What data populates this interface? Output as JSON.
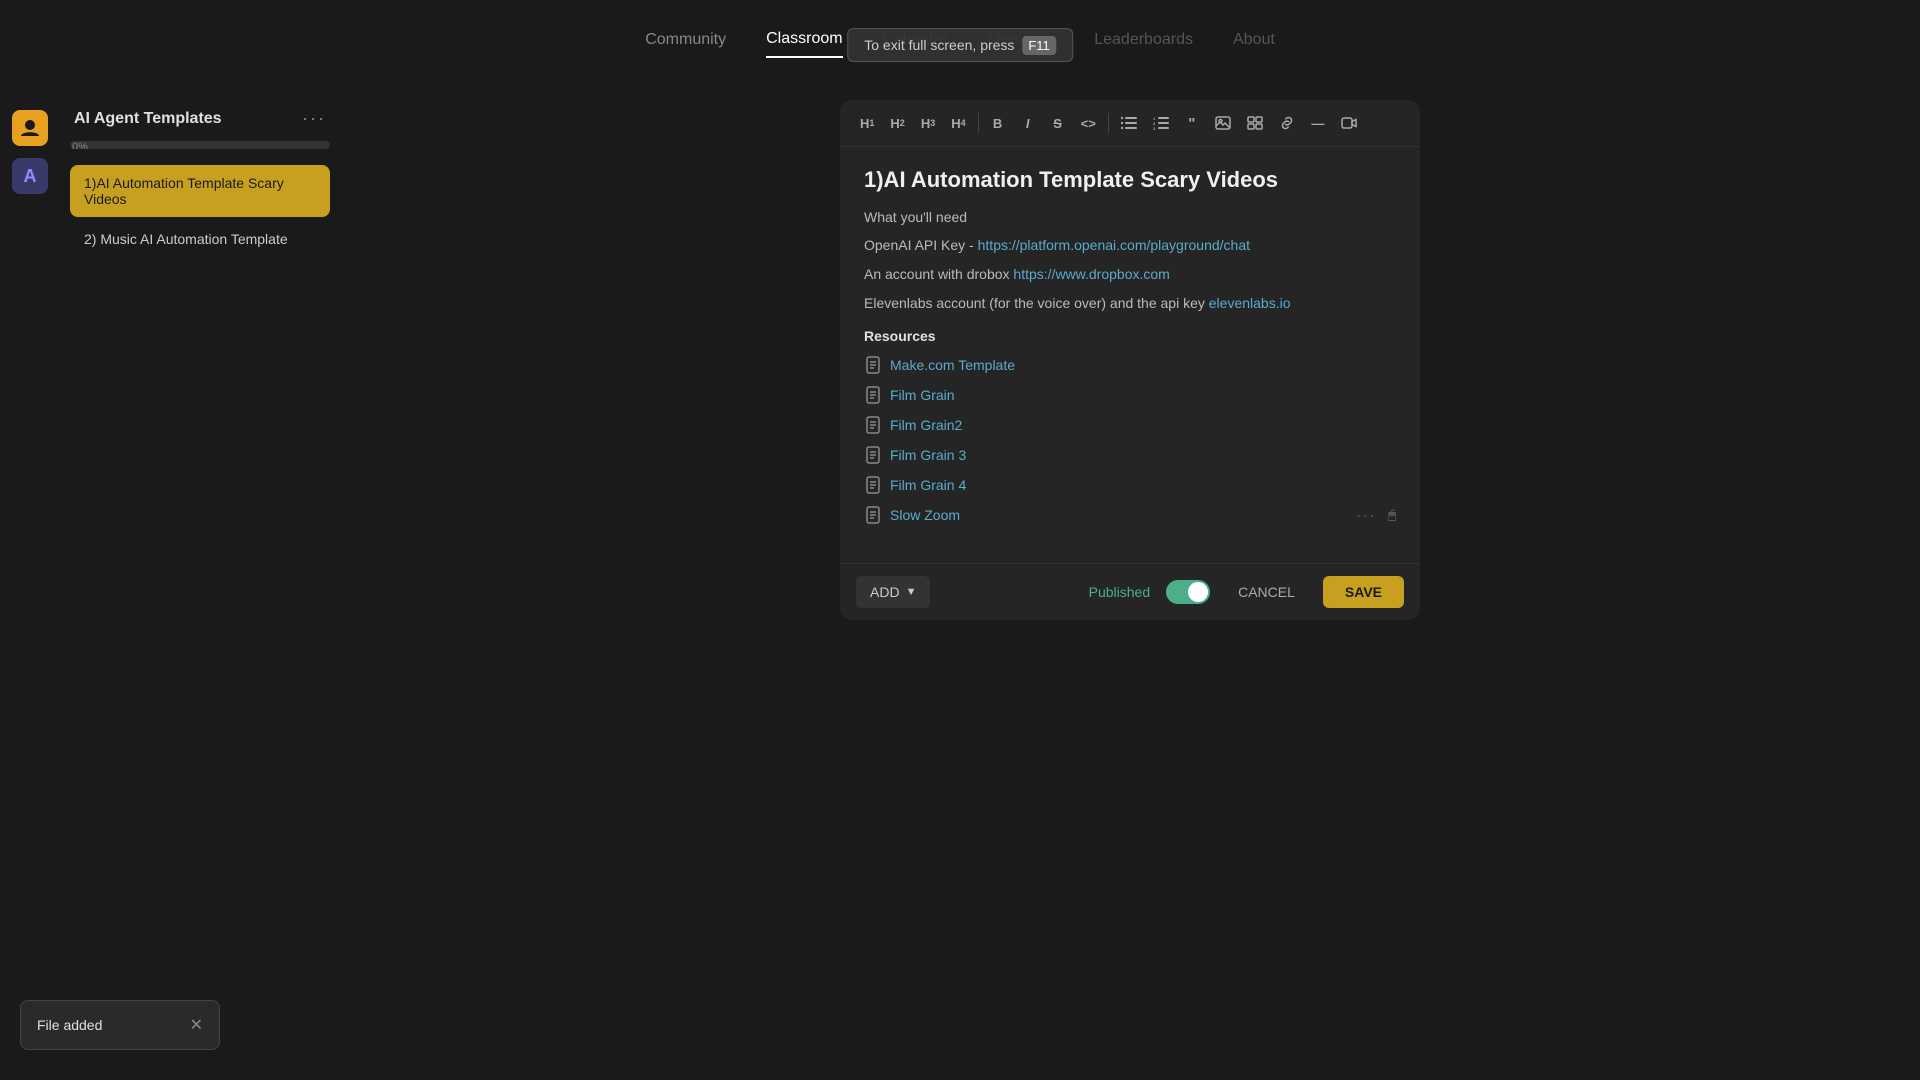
{
  "nav": {
    "items": [
      {
        "label": "Community",
        "active": false
      },
      {
        "label": "Classroom",
        "active": true
      },
      {
        "label": "Calendar",
        "active": false
      },
      {
        "label": "Members",
        "active": false
      },
      {
        "label": "Leaderboards",
        "active": false
      },
      {
        "label": "About",
        "active": false
      }
    ],
    "fullscreen_notice": "To exit full screen, press",
    "fullscreen_key": "F11"
  },
  "sidebar": {
    "title": "AI Agent Templates",
    "dots_label": "···",
    "progress_label": "0%",
    "items": [
      {
        "label": "1)AI Automation Template Scary Videos",
        "active": true
      },
      {
        "label": "2) Music AI Automation Template",
        "active": false
      }
    ]
  },
  "editor": {
    "title": "1)AI Automation Template Scary Videos",
    "what_you_need_label": "What you'll need",
    "openai_label": "OpenAI API Key -",
    "openai_link_text": "https://platform.openai.com/playground/chat",
    "openai_link_href": "https://platform.openai.com/playground/chat",
    "dropbox_label": "An account with drobox",
    "dropbox_link_text": "https://www.dropbox.com",
    "dropbox_link_href": "https://www.dropbox.com",
    "elevenlabs_label": "Elevenlabs account (for the voice over) and the api key",
    "elevenlabs_link_text": "elevenlabs.io",
    "elevenlabs_link_href": "https://elevenlabs.io",
    "resources_title": "Resources",
    "resources": [
      {
        "label": "Make.com Template",
        "has_dots": false
      },
      {
        "label": "Film Grain",
        "has_dots": false
      },
      {
        "label": "Film Grain2",
        "has_dots": false
      },
      {
        "label": "Film Grain 3",
        "has_dots": false
      },
      {
        "label": "Film Grain 4",
        "has_dots": false
      },
      {
        "label": "Slow Zoom",
        "has_dots": true
      }
    ],
    "toolbar": {
      "buttons": [
        "H1",
        "H2",
        "H3",
        "H4",
        "B",
        "I",
        "S",
        "<>",
        "❝",
        "⊟",
        "⊟",
        "❞",
        "🖼",
        "🖼",
        "🔗",
        "—",
        "▶"
      ]
    },
    "add_label": "ADD",
    "published_label": "Published",
    "cancel_label": "CANCEL",
    "save_label": "SAVE"
  },
  "toast": {
    "message": "File added",
    "close_label": "✕"
  },
  "colors": {
    "accent": "#c8a020",
    "link": "#5aabcc",
    "published": "#4caf8a"
  }
}
